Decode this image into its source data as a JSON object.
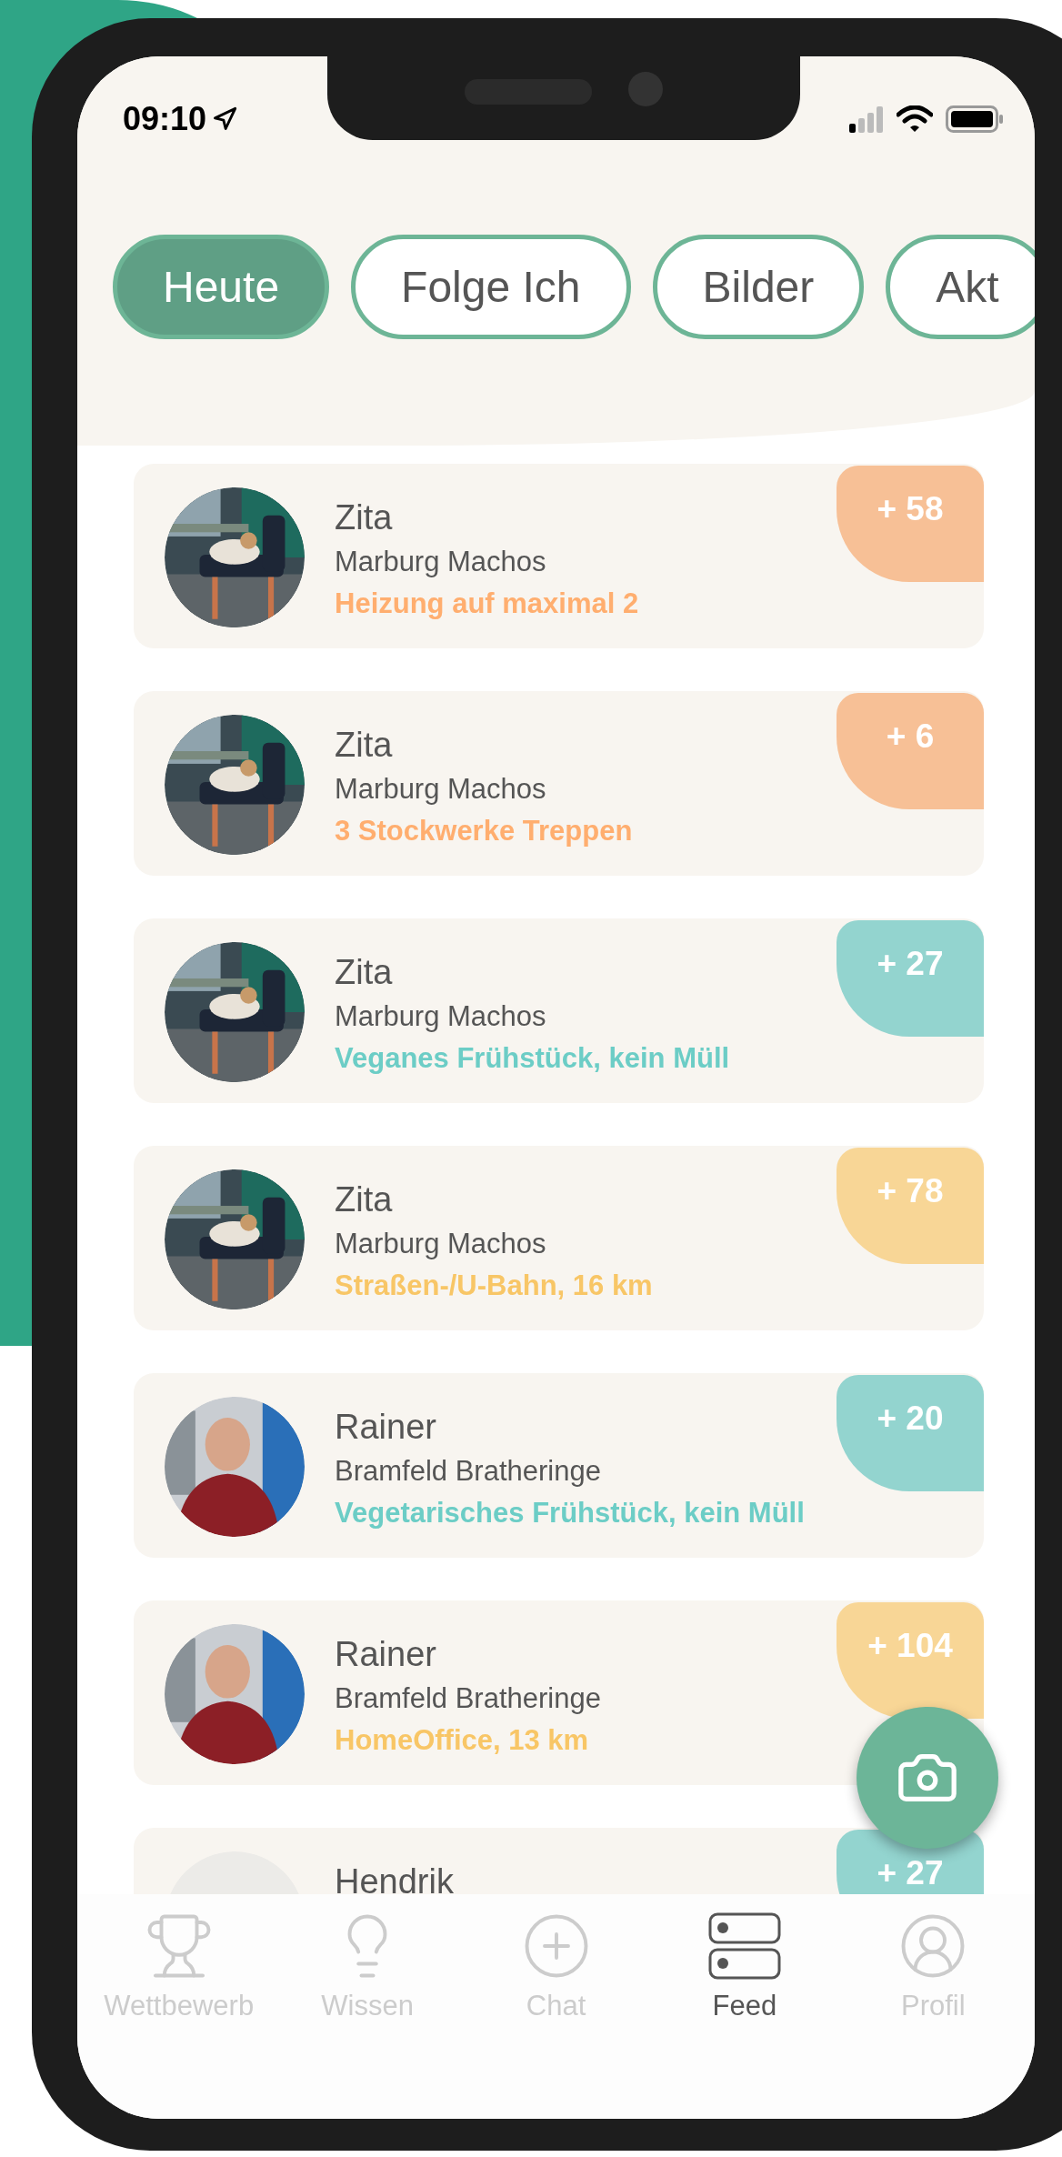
{
  "status_bar": {
    "time": "09:10"
  },
  "tabs": [
    {
      "label": "Heute",
      "selected": true
    },
    {
      "label": "Folge Ich",
      "selected": false
    },
    {
      "label": "Bilder",
      "selected": false
    },
    {
      "label": "Akt",
      "selected": false
    }
  ],
  "feed": [
    {
      "name": "Zita",
      "team": "Marburg Machos",
      "activity": "Heizung auf maximal 2",
      "points": "+ 58",
      "color": "#f7c096"
    },
    {
      "name": "Zita",
      "team": "Marburg Machos",
      "activity": "3 Stockwerke Treppen",
      "points": "+ 6",
      "color": "#f7c096"
    },
    {
      "name": "Zita",
      "team": "Marburg Machos",
      "activity": "Veganes Frühstück, kein Müll",
      "points": "+ 27",
      "color": "#93d4cf"
    },
    {
      "name": "Zita",
      "team": "Marburg Machos",
      "activity": "Straßen-/U-Bahn, 16 km",
      "points": "+ 78",
      "color": "#f8d696"
    },
    {
      "name": "Rainer",
      "team": "Bramfeld Bratheringe",
      "activity": "Vegetarisches Frühstück, kein Müll",
      "points": "+ 20",
      "color": "#93d4cf"
    },
    {
      "name": "Rainer",
      "team": "Bramfeld Bratheringe",
      "activity": "HomeOffice, 13 km",
      "points": "+ 104",
      "color": "#f8d696"
    },
    {
      "name": "Hendrik",
      "points": "+ 27",
      "color": "#93d4cf"
    }
  ],
  "bottom_nav": [
    {
      "label": "Wettbewerb",
      "selected": false
    },
    {
      "label": "Wissen",
      "selected": false
    },
    {
      "label": "Chat",
      "selected": false
    },
    {
      "label": "Feed",
      "selected": true
    },
    {
      "label": "Profil",
      "selected": false
    }
  ]
}
